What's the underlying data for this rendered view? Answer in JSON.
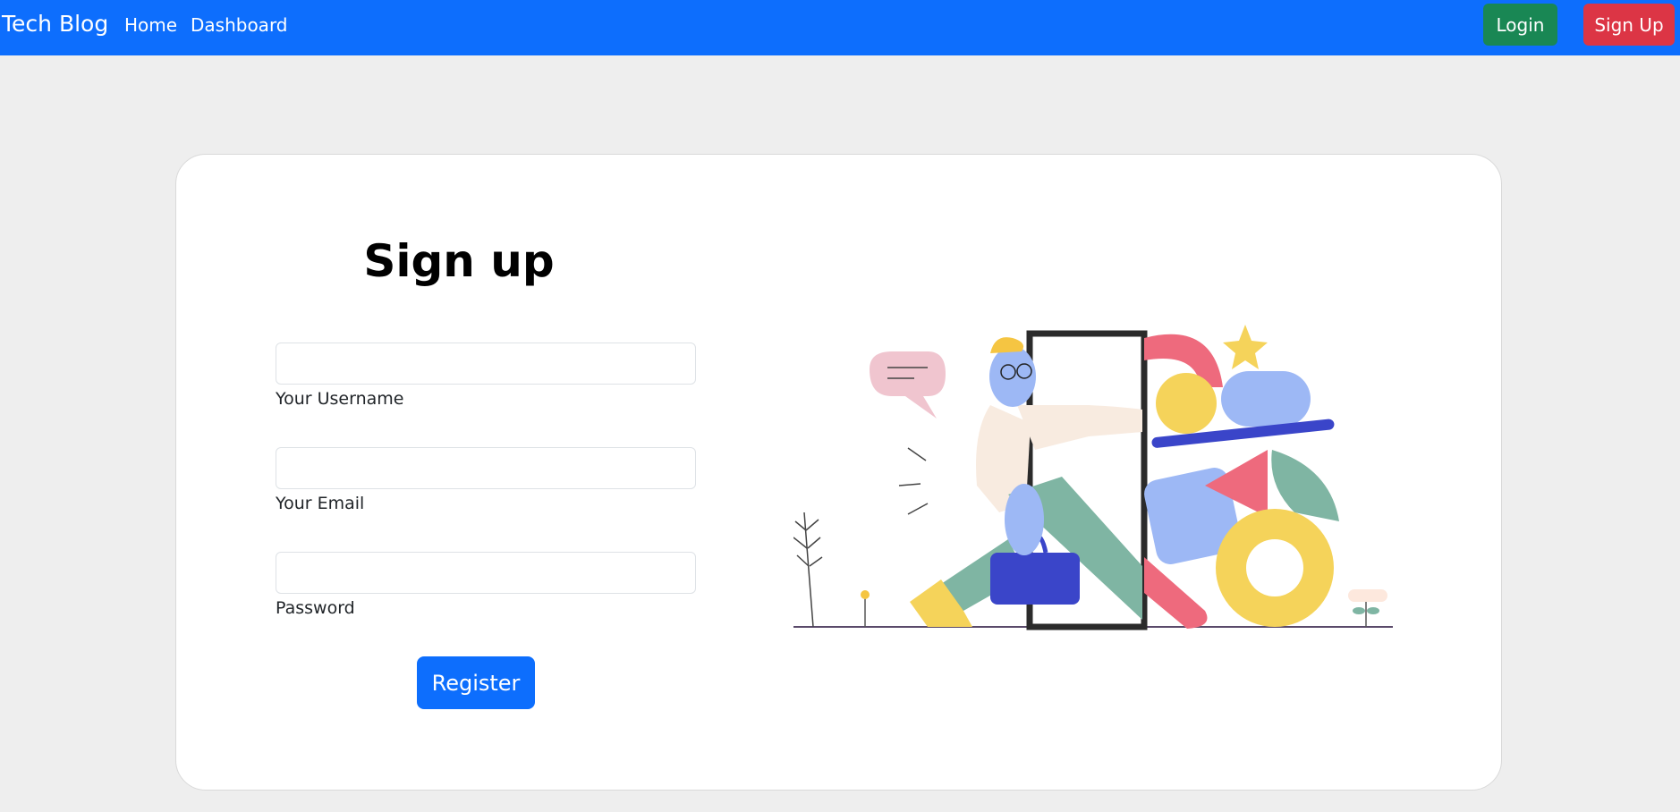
{
  "navbar": {
    "brand": "Tech Blog",
    "links": [
      "Home",
      "Dashboard"
    ],
    "login_label": "Login",
    "signup_label": "Sign Up"
  },
  "form": {
    "title": "Sign up",
    "fields": [
      {
        "label": "Your Username",
        "value": ""
      },
      {
        "label": "Your Email",
        "value": ""
      },
      {
        "label": "Password",
        "value": ""
      }
    ],
    "submit_label": "Register"
  },
  "colors": {
    "primary": "#0d6efd",
    "login": "#198754",
    "signup": "#dc3545",
    "page_bg": "#eeeeee"
  },
  "illustration": {
    "icon": "person-walking-through-door-illustration"
  }
}
